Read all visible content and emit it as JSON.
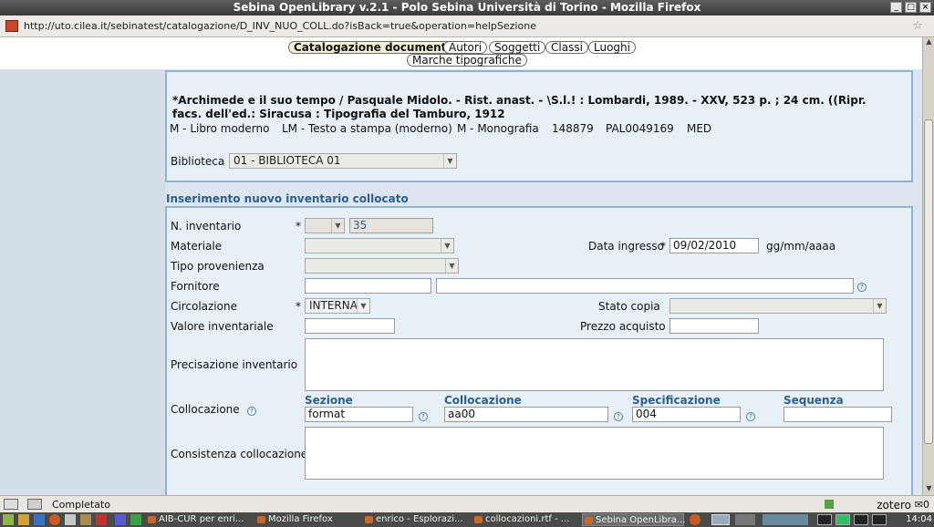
{
  "window": {
    "title": "Sebina OpenLibrary v.2.1 - Polo Sebina Università di Torino - Mozilla Firefox",
    "url": "http://uto.cilea.it/sebinatest/catalogazione/D_INV_NUO_COLL.do?isBack=true&operation=helpSezione"
  },
  "nav": {
    "catalogazione": "Catalogazione documento",
    "autori": "Autori",
    "soggetti": "Soggetti",
    "classi": "Classi",
    "luoghi": "Luoghi",
    "marche": "Marche tipografiche"
  },
  "record": {
    "title": "*Archimede e il suo tempo / Pasquale Midolo. - Rist. anast. - \\S.l.! : Lombardi, 1989. - XXV, 523 p. ; 24 cm. ((Ripr. facs. dell'ed.: Siracusa : Tipografia del Tamburo, 1912",
    "fields": [
      "M - Libro moderno",
      "LM - Testo a stampa (moderno)",
      "M - Monografia",
      "148879",
      "PAL0049169",
      "MED"
    ],
    "biblioteca_label": "Biblioteca",
    "biblioteca_value": "01 - BIBLIOTECA 01"
  },
  "form": {
    "section_title": "Inserimento nuovo inventario collocato",
    "n_inventario_label": "N. inventario",
    "n_inventario_value": "35",
    "materiale_label": "Materiale",
    "tipo_provenienza_label": "Tipo provenienza",
    "fornitore_label": "Fornitore",
    "circolazione_label": "Circolazione",
    "circolazione_value": "INTERNA",
    "valore_label": "Valore inventariale",
    "precisazione_label": "Precisazione inventario",
    "collocazione_label": "Collocazione",
    "consistenza_label": "Consistenza collocazione",
    "data_ingresso_label": "Data ingresso",
    "data_ingresso_value": "09/02/2010",
    "data_format": "gg/mm/aaaa",
    "stato_copia_label": "Stato copia",
    "prezzo_label": "Prezzo acquisto",
    "required_mark": "*",
    "help_mark": "?",
    "coll": {
      "sezione_hdr": "Sezione",
      "sezione_value": "format",
      "collocazione_hdr": "Collocazione",
      "collocazione_value": "aa00",
      "specificazione_hdr": "Specificazione",
      "specificazione_value": "004",
      "sequenza_hdr": "Sequenza",
      "sequenza_value": ""
    }
  },
  "status": {
    "text": "Completato",
    "zotero": "zotero"
  },
  "taskbar": {
    "items": [
      "AIB-CUR per enri...",
      "Mozilla Firefox",
      "enrico - Esplorazi...",
      "collocazioni.rtf - ...",
      "Sebina OpenLibra..."
    ],
    "clock": "14:04"
  }
}
